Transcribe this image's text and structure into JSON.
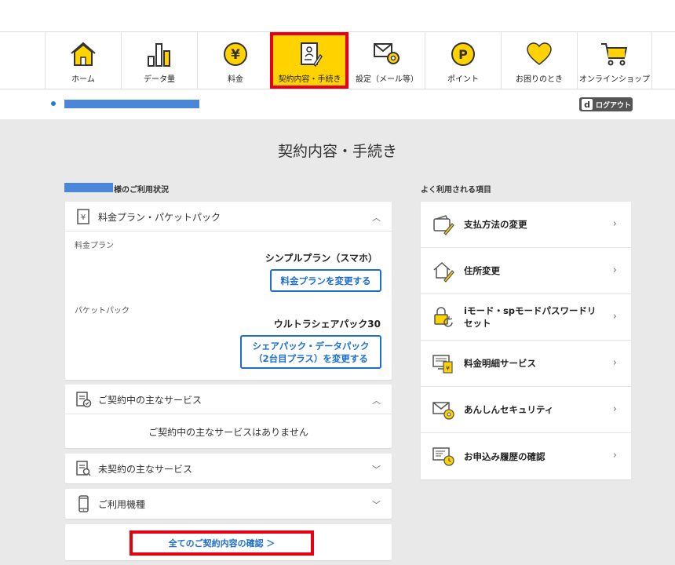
{
  "nav": {
    "items": [
      {
        "label": "ホーム",
        "icon": "home-icon"
      },
      {
        "label": "データ量",
        "icon": "bar-chart-icon"
      },
      {
        "label": "料金",
        "icon": "yen-icon"
      },
      {
        "label": "契約内容・手続き",
        "icon": "contract-icon",
        "active": true
      },
      {
        "label": "設定（メール等）",
        "icon": "mail-gear-icon"
      },
      {
        "label": "ポイント",
        "icon": "point-icon"
      },
      {
        "label": "お困りのとき",
        "icon": "heart-icon"
      },
      {
        "label": "オンラインショップ",
        "icon": "cart-icon"
      }
    ]
  },
  "user": {
    "logout_label": "ログアウト",
    "logout_mark": "d"
  },
  "page": {
    "title": "契約内容・手続き"
  },
  "left": {
    "section_label": "様のご利用状況",
    "plan_card": {
      "title": "料金プラン・パケットパック",
      "plan_label": "料金プラン",
      "plan_value": "シンプルプラン（スマホ）",
      "plan_button": "料金プランを変更する",
      "packet_label": "パケットパック",
      "packet_value": "ウルトラシェアパック30",
      "packet_button_line1": "シェアパック・データパック",
      "packet_button_line2": "（2台目プラス）を変更する"
    },
    "services_card": {
      "title": "ご契約中の主なサービス",
      "empty_text": "ご契約中の主なサービスはありません"
    },
    "uncontracted_card": {
      "title": "未契約の主なサービス"
    },
    "device_card": {
      "title": "ご利用機種"
    },
    "all_link": "全てのご契約内容の確認 ＞"
  },
  "right": {
    "section_label": "よく利用される項目",
    "items": [
      {
        "label": "支払方法の変更",
        "icon": "wallet-pen-icon"
      },
      {
        "label": "住所変更",
        "icon": "house-pen-icon"
      },
      {
        "label": "iモード・spモードパスワードリセット",
        "icon": "lock-reset-icon"
      },
      {
        "label": "料金明細サービス",
        "icon": "bill-screen-icon"
      },
      {
        "label": "あんしんセキュリティ",
        "icon": "mail-security-icon"
      },
      {
        "label": "お申込み履歴の確認",
        "icon": "history-clock-icon"
      }
    ]
  },
  "colors": {
    "accent": "#ffd200",
    "highlight": "#e60012",
    "link": "#1c6fd1",
    "redaction": "#4a86d9"
  }
}
